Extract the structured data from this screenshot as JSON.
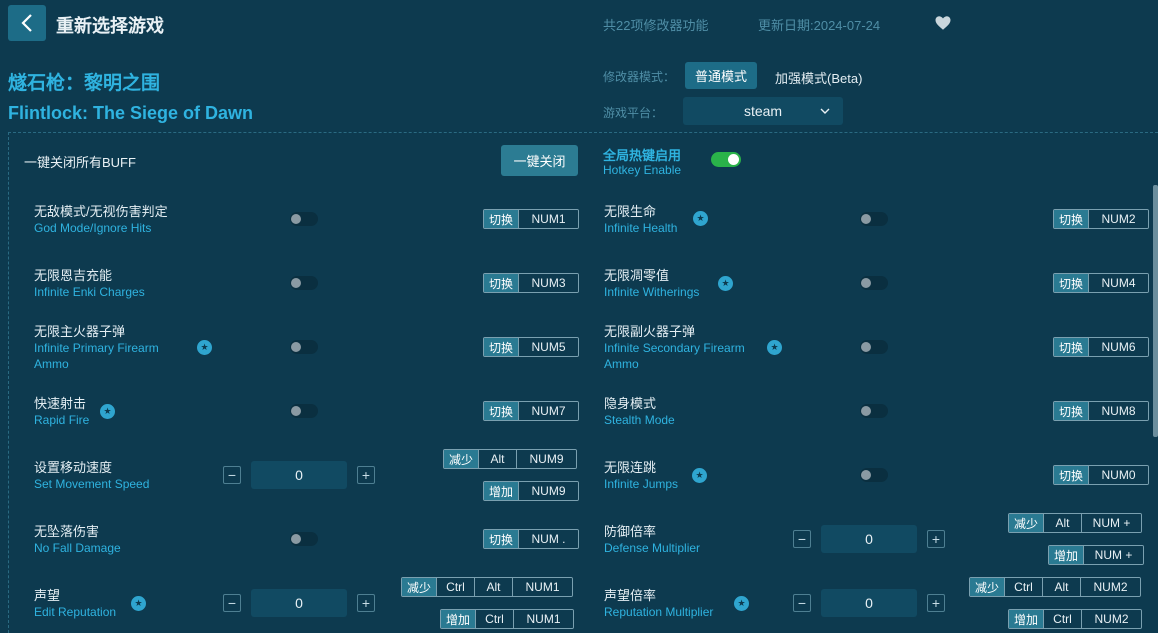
{
  "header": {
    "title": "重新选择游戏",
    "feature_count": "共22项修改器功能",
    "update_date": "更新日期:2024-07-24"
  },
  "game": {
    "name_cn": "燧石枪：黎明之围",
    "name_en": "Flintlock: The Siege of Dawn"
  },
  "mode": {
    "label": "修改器模式：",
    "normal": "普通模式",
    "enhanced": "加强模式(Beta)"
  },
  "platform": {
    "label": "游戏平台：",
    "value": "steam"
  },
  "controls": {
    "all_off_label": "一键关闭所有BUFF",
    "all_off_button": "一键关闭",
    "hotkey_cn": "全局热键启用",
    "hotkey_en": "Hotkey Enable"
  },
  "cheats": [
    {
      "cn": "无敌模式/无视伤害判定",
      "en": "God Mode/Ignore Hits",
      "action": "切换",
      "keys": [
        "NUM1"
      ]
    },
    {
      "cn": "无限生命",
      "en": "Infinite Health",
      "action": "切换",
      "keys": [
        "NUM2"
      ]
    },
    {
      "cn": "无限恩吉充能",
      "en": "Infinite Enki Charges",
      "action": "切换",
      "keys": [
        "NUM3"
      ]
    },
    {
      "cn": "无限凋零值",
      "en": "Infinite Witherings",
      "action": "切换",
      "keys": [
        "NUM4"
      ]
    },
    {
      "cn": "无限主火器子弹",
      "en": "Infinite Primary Firearm",
      "en2": "Ammo",
      "action": "切换",
      "keys": [
        "NUM5"
      ]
    },
    {
      "cn": "无限副火器子弹",
      "en": "Infinite Secondary Firearm",
      "en2": "Ammo",
      "action": "切换",
      "keys": [
        "NUM6"
      ]
    },
    {
      "cn": "快速射击",
      "en": "Rapid Fire",
      "action": "切换",
      "keys": [
        "NUM7"
      ]
    },
    {
      "cn": "隐身模式",
      "en": "Stealth Mode",
      "action": "切换",
      "keys": [
        "NUM8"
      ]
    },
    {
      "cn": "设置移动速度",
      "en": "Set Movement Speed",
      "value": "0",
      "dec": {
        "action": "减少",
        "keys": [
          "Alt",
          "NUM9"
        ]
      },
      "inc": {
        "action": "增加",
        "keys": [
          "NUM9"
        ]
      }
    },
    {
      "cn": "无限连跳",
      "en": "Infinite Jumps",
      "action": "切换",
      "keys": [
        "NUM0"
      ]
    },
    {
      "cn": "无坠落伤害",
      "en": "No Fall Damage",
      "action": "切换",
      "keys": [
        "NUM ."
      ]
    },
    {
      "cn": "防御倍率",
      "en": "Defense Multiplier",
      "value": "0",
      "dec": {
        "action": "减少",
        "keys": [
          "Alt",
          "NUM +"
        ]
      },
      "inc": {
        "action": "增加",
        "keys": [
          "NUM +"
        ]
      }
    },
    {
      "cn": "声望",
      "en": "Edit Reputation",
      "value": "0",
      "dec": {
        "action": "减少",
        "keys": [
          "Ctrl",
          "Alt",
          "NUM1"
        ]
      },
      "inc": {
        "action": "增加",
        "keys": [
          "Ctrl",
          "NUM1"
        ]
      }
    },
    {
      "cn": "声望倍率",
      "en": "Reputation Multiplier",
      "value": "0",
      "dec": {
        "action": "减少",
        "keys": [
          "Ctrl",
          "Alt",
          "NUM2"
        ]
      },
      "inc": {
        "action": "增加",
        "keys": [
          "Ctrl",
          "NUM2"
        ]
      }
    }
  ],
  "stepper": {
    "minus": "−",
    "plus": "+"
  },
  "icons": {
    "back": "chevron-left-icon",
    "favorite": "heart-icon",
    "star": "star-icon",
    "dropdown": "chevron-down-icon"
  },
  "colors": {
    "background": "#0d3a4f",
    "accent": "#2fb3e0",
    "button": "#1d6c87",
    "toggle_on": "#2ab34a"
  }
}
